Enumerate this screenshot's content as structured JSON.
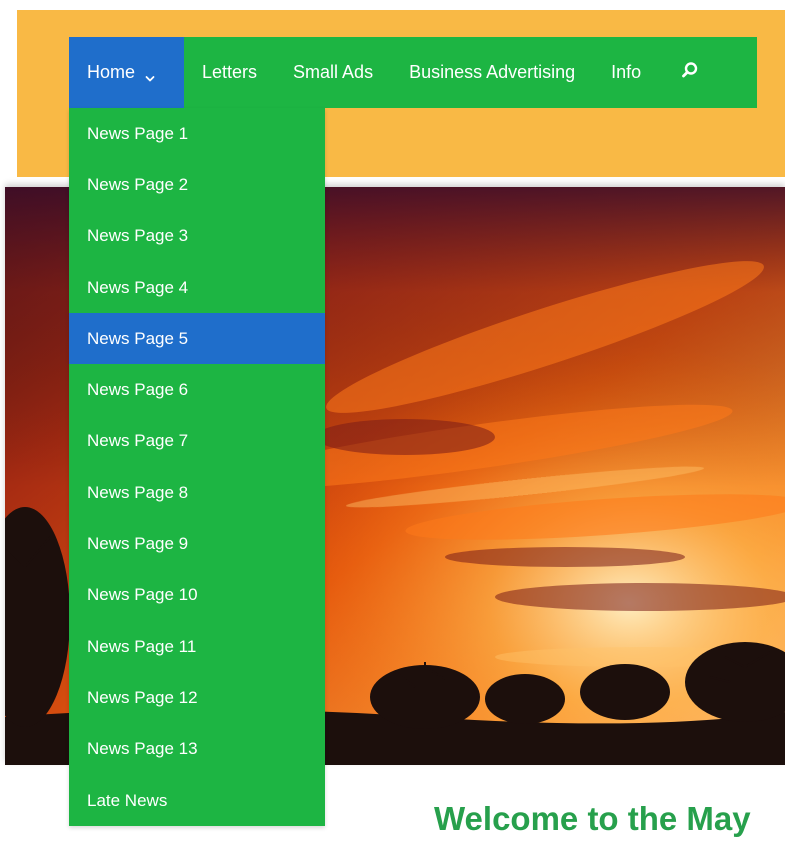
{
  "nav": {
    "items": [
      {
        "label": "Home",
        "active": true,
        "has_dropdown": true
      },
      {
        "label": "Letters"
      },
      {
        "label": "Small Ads"
      },
      {
        "label": "Business Advertising"
      },
      {
        "label": "Info"
      }
    ],
    "search_icon": "search-icon",
    "dropdown_icon": "chevron-down-icon"
  },
  "dropdown": {
    "items": [
      "News Page 1",
      "News Page 2",
      "News Page 3",
      "News Page 4",
      "News Page 5",
      "News Page 6",
      "News Page 7",
      "News Page 8",
      "News Page 9",
      "News Page 10",
      "News Page 11",
      "News Page 12",
      "News Page 13",
      "Late News"
    ],
    "highlighted": "News Page 5"
  },
  "main": {
    "heading": "Welcome to the May"
  },
  "colors": {
    "header_band": "#f9b945",
    "nav_green": "#1db543",
    "active_blue": "#1f6ecb",
    "heading_green": "#27a04c"
  }
}
